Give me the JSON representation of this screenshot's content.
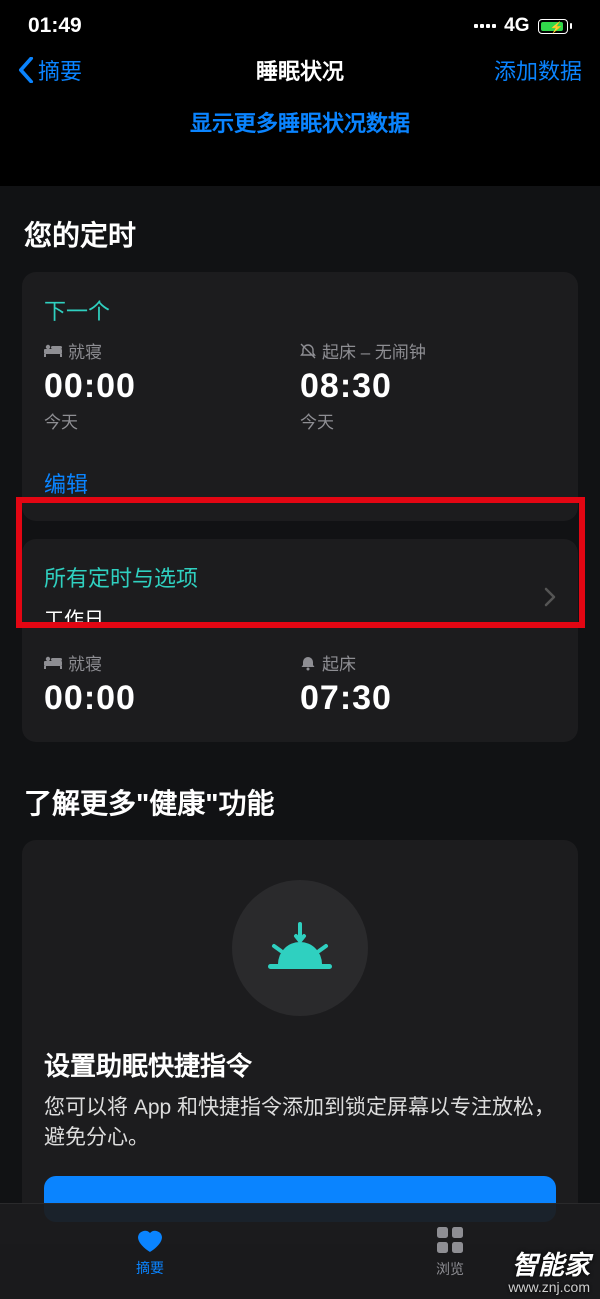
{
  "status": {
    "time": "01:49",
    "network": "4G"
  },
  "nav": {
    "back": "摘要",
    "title": "睡眠状况",
    "add": "添加数据"
  },
  "showMore": "显示更多睡眠状况数据",
  "sections": {
    "schedule": {
      "title": "您的定时",
      "next": {
        "label": "下一个",
        "bed": {
          "label": "就寝",
          "time": "00:00",
          "day": "今天"
        },
        "wake": {
          "label": "起床 – 无闹钟",
          "time": "08:30",
          "day": "今天"
        },
        "edit": "编辑"
      },
      "all": {
        "title": "所有定时与选项",
        "subtitle": "工作日",
        "bed": {
          "label": "就寝",
          "time": "00:00"
        },
        "wake": {
          "label": "起床",
          "time": "07:30"
        }
      }
    },
    "learn": {
      "title": "了解更多\"健康\"功能",
      "feature": {
        "title": "设置助眠快捷指令",
        "desc": "您可以将 App 和快捷指令添加到锁定屏幕以专注放松，避免分心。"
      }
    }
  },
  "tabs": {
    "summary": "摘要",
    "browse": "浏览"
  },
  "watermark": {
    "line1": "智能家",
    "line2": "www.znj.com"
  }
}
